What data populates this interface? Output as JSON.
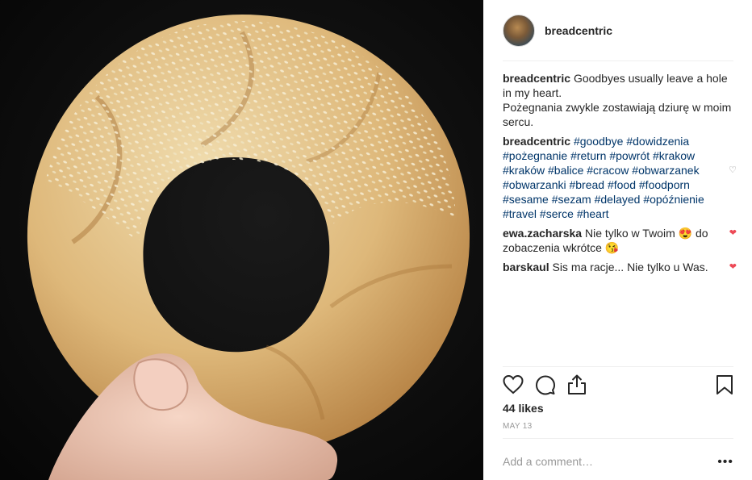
{
  "post": {
    "image_alt": "Hand holding a braided sesame obwarzanek bagel ring"
  },
  "header": {
    "username": "breadcentric"
  },
  "caption": {
    "username": "breadcentric",
    "text": "Goodbyes usually leave a hole in my heart.\nPożegnania zwykle zostawiają dziurę w moim sercu."
  },
  "comments": [
    {
      "username": "breadcentric",
      "text": "#goodbye #dowidzenia #pożegnanie #return #powrót #krakow #kraków #balice #cracow #obwarzanek #obwarzanki #bread #food #foodporn #sesame #sezam #delayed #opóźnienie #travel #serce #heart",
      "liked": false
    },
    {
      "username": "ewa.zacharska",
      "text": "Nie tylko w Twoim 😍 do zobaczenia wkrótce 😘",
      "liked": true
    },
    {
      "username": "barskaul",
      "text": "Sis ma racje... Nie tylko u Was.",
      "liked": true
    }
  ],
  "icons": {
    "like": "heart-outline-icon",
    "comment": "speech-bubble-icon",
    "share": "share-icon",
    "save": "bookmark-icon",
    "more": "ellipsis-icon"
  },
  "likes": "44 likes",
  "date": "MAY 13",
  "add_comment": {
    "placeholder": "Add a comment…",
    "more": "•••"
  },
  "colors": {
    "link": "#003569",
    "heart_red": "#ed4956",
    "muted": "#999999",
    "divider": "#efefef"
  }
}
